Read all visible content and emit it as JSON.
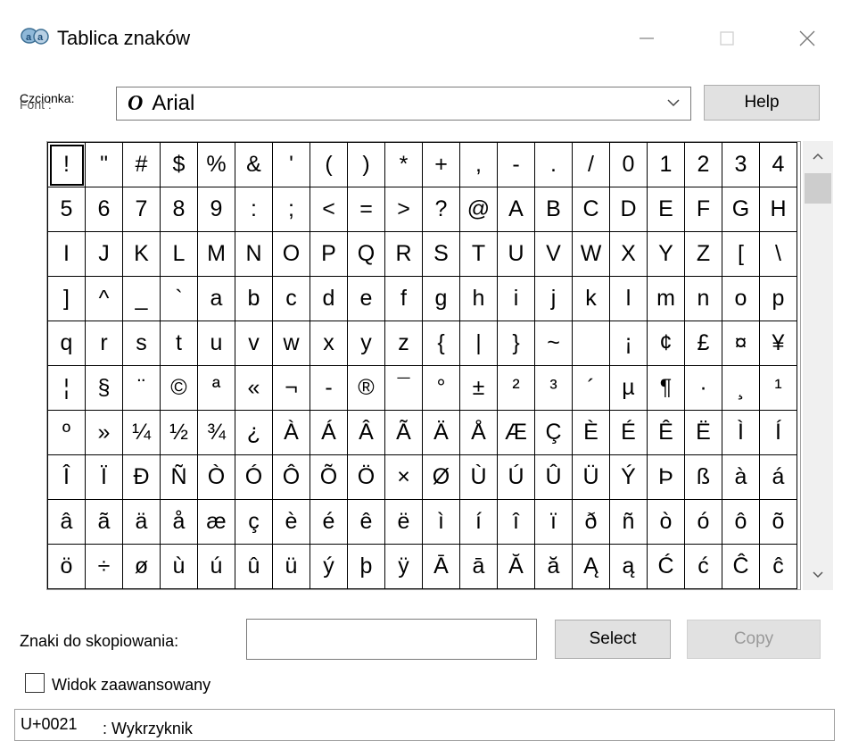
{
  "window": {
    "title": "Tablica znaków",
    "app_icon": "charmap-app-icon",
    "controls": [
      "minimize-icon",
      "maximize-icon",
      "close-icon"
    ]
  },
  "font": {
    "label": "Czcionka:",
    "label_ghost": "Font :",
    "font_type_glyph": "O",
    "selected": "Arial",
    "help_label": "Help"
  },
  "characters": [
    "!",
    "\"",
    "#",
    "$",
    "%",
    "&",
    "'",
    "(",
    ")",
    "*",
    "+",
    ",",
    "-",
    ".",
    "/",
    "0",
    "1",
    "2",
    "3",
    "4",
    "5",
    "6",
    "7",
    "8",
    "9",
    ":",
    ";",
    "<",
    "=",
    ">",
    "?",
    "@",
    "A",
    "B",
    "C",
    "D",
    "E",
    "F",
    "G",
    "H",
    "I",
    "J",
    "K",
    "L",
    "M",
    "N",
    "O",
    "P",
    "Q",
    "R",
    "S",
    "T",
    "U",
    "V",
    "W",
    "X",
    "Y",
    "Z",
    "[",
    "\\",
    "]",
    "^",
    "_",
    "`",
    "a",
    "b",
    "c",
    "d",
    "e",
    "f",
    "g",
    "h",
    "i",
    "j",
    "k",
    "l",
    "m",
    "n",
    "o",
    "p",
    "q",
    "r",
    "s",
    "t",
    "u",
    "v",
    "w",
    "x",
    "y",
    "z",
    "{",
    "|",
    "}",
    "~",
    " ",
    "¡",
    "¢",
    "£",
    "¤",
    "¥",
    "¦",
    "§",
    "¨",
    "©",
    "ª",
    "«",
    "¬",
    "-",
    "®",
    "¯",
    "°",
    "±",
    "²",
    "³",
    "´",
    "µ",
    "¶",
    "·",
    "¸",
    "¹",
    "º",
    "»",
    "¼",
    "½",
    "¾",
    "¿",
    "À",
    "Á",
    "Â",
    "Ã",
    "Ä",
    "Å",
    "Æ",
    "Ç",
    "È",
    "É",
    "Ê",
    "Ë",
    "Ì",
    "Í",
    "Î",
    "Ï",
    "Ð",
    "Ñ",
    "Ò",
    "Ó",
    "Ô",
    "Õ",
    "Ö",
    "×",
    "Ø",
    "Ù",
    "Ú",
    "Û",
    "Ü",
    "Ý",
    "Þ",
    "ß",
    "à",
    "á",
    "â",
    "ã",
    "ä",
    "å",
    "æ",
    "ç",
    "è",
    "é",
    "ê",
    "ë",
    "ì",
    "í",
    "î",
    "ï",
    "ð",
    "ñ",
    "ò",
    "ó",
    "ô",
    "õ",
    "ö",
    "÷",
    "ø",
    "ù",
    "ú",
    "û",
    "ü",
    "ý",
    "þ",
    "ÿ",
    "Ā",
    "ā",
    "Ă",
    "ă",
    "Ą",
    "ą",
    "Ć",
    "ć",
    "Ĉ",
    "ĉ"
  ],
  "selected_character_index": 0,
  "copy": {
    "label": "Znaki do skopiowania:",
    "value": "",
    "select_label": "Select",
    "copy_label": "Copy"
  },
  "advanced_view": {
    "label": "Widok zaawansowany",
    "checked": false
  },
  "status": {
    "code": "U+0021",
    "name": ": Wykrzyknik"
  }
}
